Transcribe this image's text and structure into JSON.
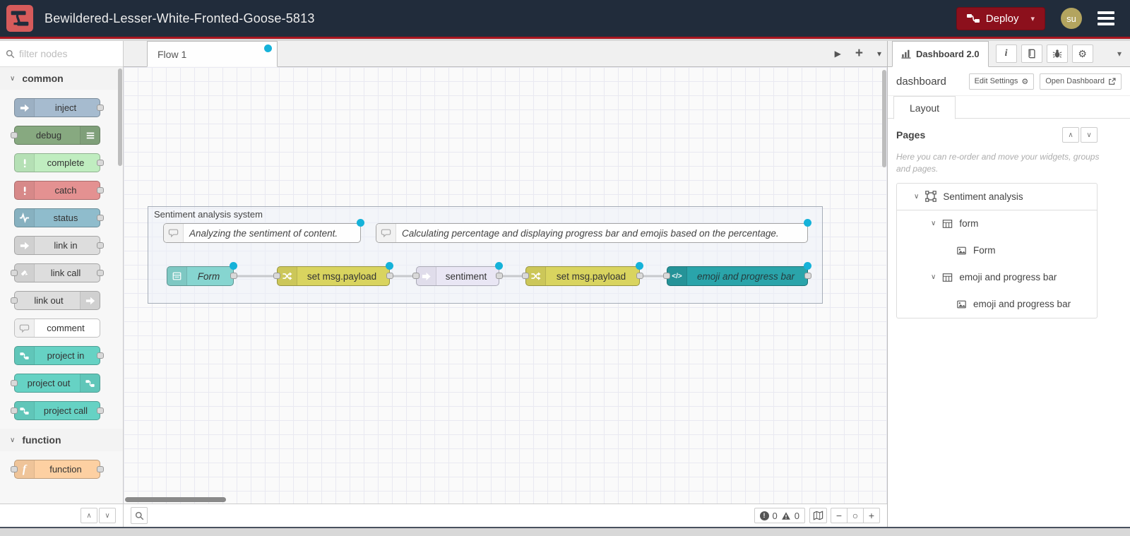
{
  "header": {
    "title": "Bewildered-Lesser-White-Fronted-Goose-5813",
    "deploy_label": "Deploy",
    "user_initials": "su"
  },
  "colors": {
    "header_bg": "#212c3b",
    "brand_red": "#8C101C",
    "changed_dot": "#15b2d9"
  },
  "glyphs": {
    "caret_down": "▾",
    "chevron_down": "∨",
    "chevron_up": "∧",
    "play": "▶",
    "plus": "+",
    "minus": "−",
    "zoom_reset": "○",
    "function_f": "f",
    "code": "</>",
    "info": "i",
    "gear": "⚙",
    "bang": "!"
  },
  "palette": {
    "filter_placeholder": "filter nodes",
    "categories": [
      {
        "label": "common",
        "items": [
          {
            "label": "inject",
            "color": "#a6bbcf"
          },
          {
            "label": "debug",
            "color": "#87a980"
          },
          {
            "label": "complete",
            "color": "#c0edc0"
          },
          {
            "label": "catch",
            "color": "#e49191"
          },
          {
            "label": "status",
            "color": "#8fbccc"
          },
          {
            "label": "link in",
            "color": "#dddddd"
          },
          {
            "label": "link call",
            "color": "#dddddd"
          },
          {
            "label": "link out",
            "color": "#dddddd"
          },
          {
            "label": "comment",
            "color": "#ffffff"
          },
          {
            "label": "project in",
            "color": "#66d2c4"
          },
          {
            "label": "project out",
            "color": "#66d2c4"
          },
          {
            "label": "project call",
            "color": "#66d2c4"
          }
        ]
      },
      {
        "label": "function",
        "items": [
          {
            "label": "function",
            "color": "#fdd0a2"
          }
        ]
      }
    ]
  },
  "workspace": {
    "tab_label": "Flow 1",
    "group_label": "Sentiment analysis system",
    "comments": [
      {
        "label": "Analyzing the sentiment of content."
      },
      {
        "label": "Calculating percentage and displaying progress bar and emojis based on the percentage."
      }
    ],
    "nodes": [
      {
        "label": "Form",
        "color": "#86d5d0"
      },
      {
        "label": "set msg.payload",
        "color": "#d9d45f"
      },
      {
        "label": "sentiment",
        "color": "#e9e6f4"
      },
      {
        "label": "set msg.payload",
        "color": "#d9d45f"
      },
      {
        "label": "emoji and progress bar",
        "color": "#2aa4aa"
      }
    ]
  },
  "sidebar": {
    "tab_label": "Dashboard 2.0",
    "name": "dashboard",
    "edit_settings_label": "Edit Settings",
    "open_dashboard_label": "Open Dashboard",
    "layout_tab_label": "Layout",
    "pages_title": "Pages",
    "help_text": "Here you can re-order and move your widgets, groups and pages.",
    "tree": [
      {
        "label": "Sentiment analysis"
      },
      {
        "label": "form"
      },
      {
        "label": "Form"
      },
      {
        "label": "emoji and progress bar"
      },
      {
        "label": "emoji and progress bar"
      }
    ]
  },
  "footer": {
    "error_count": "0",
    "warning_count": "0"
  }
}
